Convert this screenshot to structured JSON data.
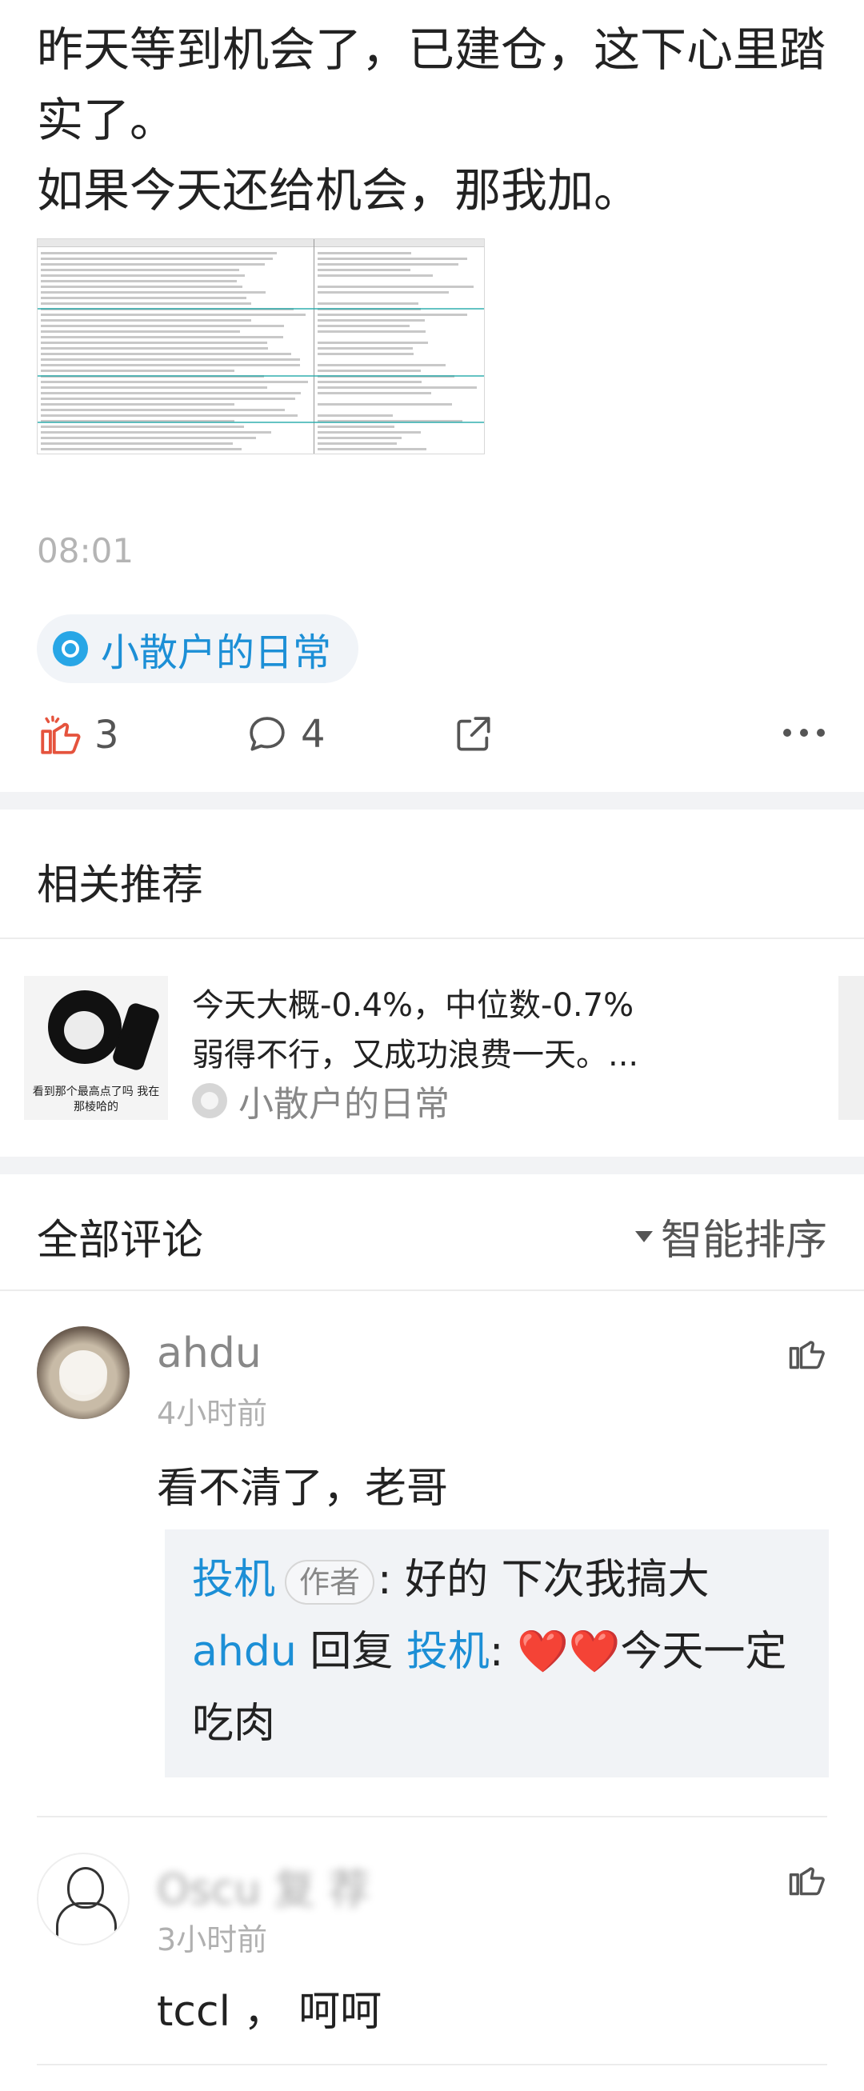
{
  "post": {
    "line1": "昨天等到机会了，已建仓，这下心里踏实了。",
    "line2": "如果今天还给机会，那我加。",
    "time": "08:01",
    "topic": "小散户的日常"
  },
  "actions": {
    "like_count": "3",
    "comment_count": "4",
    "like_icon": "thumb-up-icon",
    "comment_icon": "comment-bubble-icon",
    "share_icon": "share-icon",
    "more_icon": "more-dots-icon",
    "accent": "#e5533d"
  },
  "recommend": {
    "title": "相关推荐",
    "card": {
      "line1": "今天大概-0.4%，中位数-0.7%",
      "line2": "弱得不行，又成功浪费一天。...",
      "topic": "小散户的日常",
      "thumb_caption": "看到那个最高点了吗 我在那棱哈的"
    }
  },
  "comments_section": {
    "title": "全部评论",
    "sort_label": "智能排序"
  },
  "comments": [
    {
      "user": "ahdu",
      "time": "4小时前",
      "text": "看不清了，老哥",
      "replies": [
        {
          "from": "投机",
          "tag": "作者",
          "text": ": 好的 下次我搞大"
        },
        {
          "from": "ahdu",
          "verb": "回复",
          "to": "投机",
          "text": ": ❤️❤️今天一定吃肉"
        }
      ]
    },
    {
      "user": "Oscu 复 荐",
      "time": "3小时前",
      "text": "tccl ， 呵呵"
    }
  ],
  "colors": {
    "link_blue": "#1c8fd6",
    "topic_blue": "#28a6e6",
    "muted": "#b0b0b0",
    "reply_bg": "#f1f3f6"
  }
}
